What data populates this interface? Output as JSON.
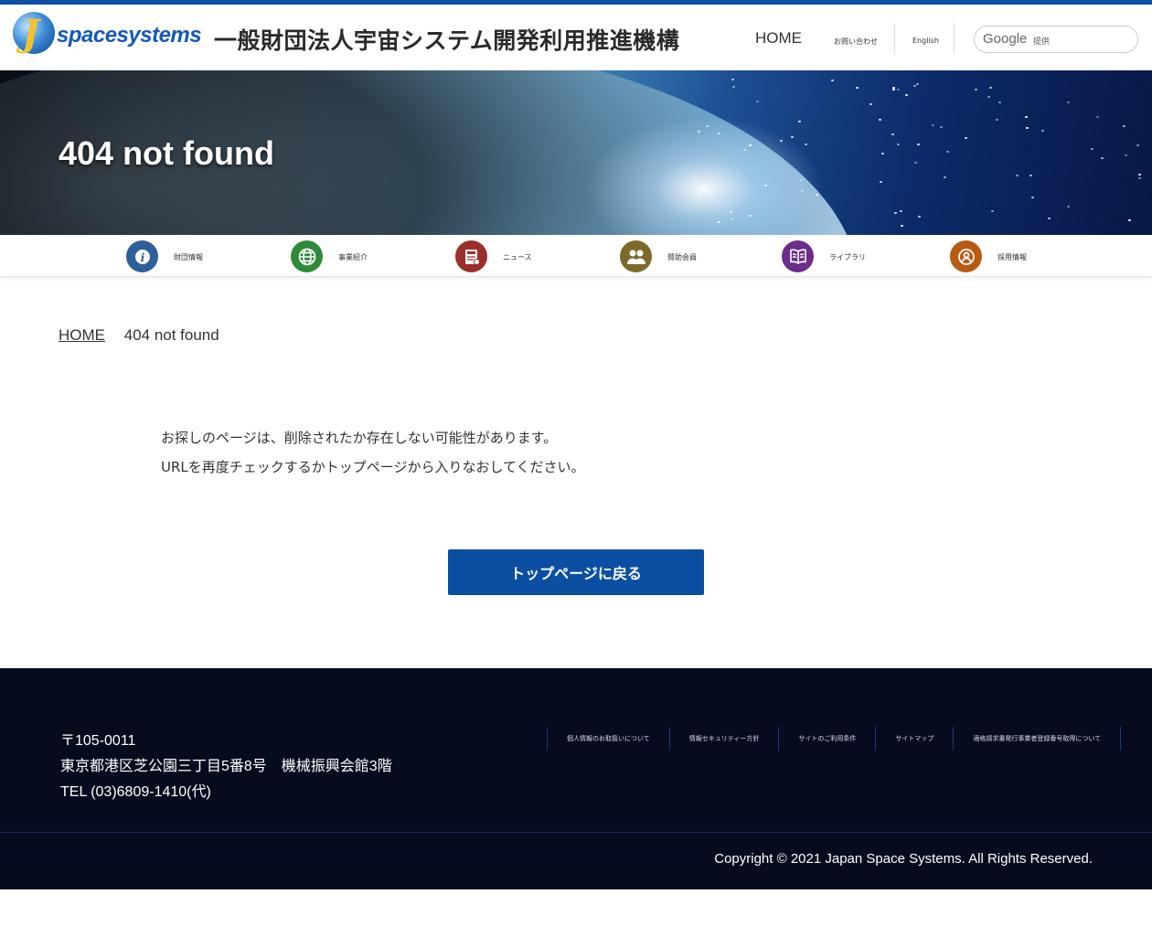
{
  "header": {
    "logo_text": "spacesystems",
    "site_title": "一般財団法人宇宙システム開発利用推進機構",
    "nav_home": "HOME",
    "nav_contact": "お問い合わせ",
    "nav_english": "English",
    "search_brand": "Google",
    "search_provided": "提供"
  },
  "hero": {
    "title": "404 not found"
  },
  "menu": [
    {
      "label": "財団情報",
      "icon": "info-icon",
      "color": "#2f5f9a"
    },
    {
      "label": "事業紹介",
      "icon": "globe-icon",
      "color": "#2e8b3a"
    },
    {
      "label": "ニュース",
      "icon": "news-icon",
      "color": "#9b2f2a"
    },
    {
      "label": "賛助会員",
      "icon": "members-icon",
      "color": "#7d6a2a"
    },
    {
      "label": "ライブラリ",
      "icon": "book-icon",
      "color": "#6a2d8a"
    },
    {
      "label": "採用情報",
      "icon": "recruit-search-icon",
      "color": "#b85a12"
    }
  ],
  "breadcrumb": {
    "home": "HOME",
    "current": "404 not found"
  },
  "message": {
    "line1": "お探しのページは、削除されたか存在しない可能性があります。",
    "line2": "URLを再度チェックするかトップページから入りなおしてください。"
  },
  "back_button": "トップページに戻る",
  "footer": {
    "postal": "〒105-0011",
    "address": "東京都港区芝公園三丁目5番8号　機械振興会館3階",
    "tel": "TEL (03)6809-1410(代)",
    "links": [
      "個人情報のお取扱いについて",
      "情報セキュリティー方針",
      "サイトのご利用条件",
      "サイトマップ",
      "適格請求書発行事業者登録番号取得について"
    ],
    "copyright": "Copyright © 2021 Japan Space Systems. All Rights Reserved."
  },
  "colors": {
    "brand_blue": "#0b4ea2",
    "footer_bg": "#070b1e"
  }
}
